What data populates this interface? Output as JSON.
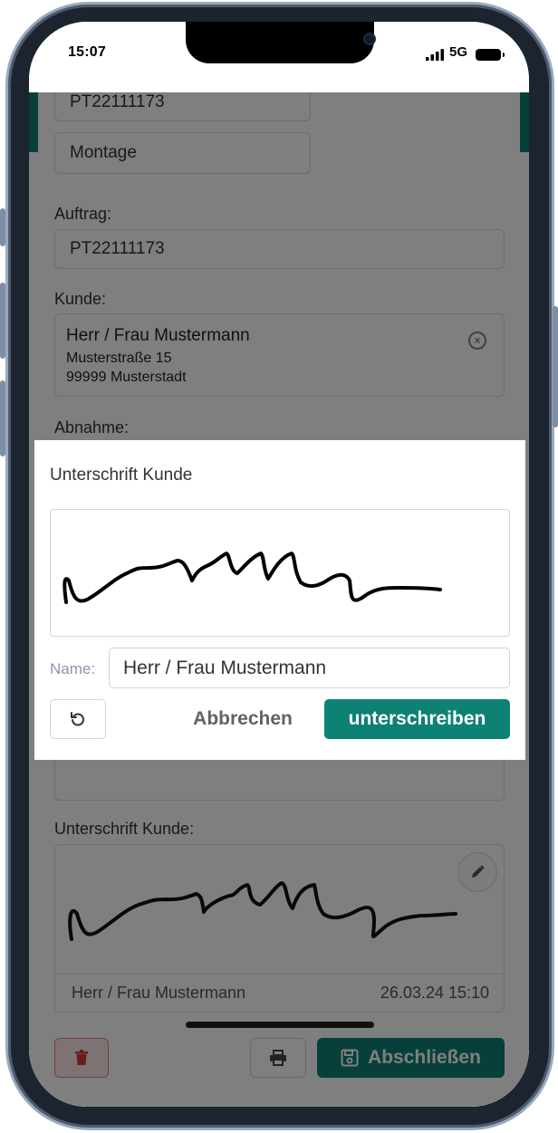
{
  "status_bar": {
    "time": "15:07",
    "network": "5G",
    "signal_icon": "signal-bars-icon",
    "battery_icon": "battery-icon"
  },
  "form": {
    "order_number_top": "PT22111173",
    "type_value": "Montage",
    "auftrag_label": "Auftrag:",
    "auftrag_value": "PT22111173",
    "kunde_label": "Kunde:",
    "kunde_name": "Herr / Frau Mustermann",
    "kunde_street": "Musterstraße 15",
    "kunde_city": "99999 Musterstadt",
    "abnahme_label": "Abnahme:",
    "signature_label": "Unterschrift Kunde:",
    "signature_name": "Herr / Frau Mustermann",
    "signature_date": "26.03.24 15:10",
    "finish_label": "Abschließen"
  },
  "modal": {
    "title": "Unterschrift Kunde",
    "name_label": "Name:",
    "name_value": "Herr / Frau Mustermann",
    "cancel_label": "Abbrechen",
    "sign_label": "unterschreiben"
  },
  "colors": {
    "accent": "#0e8175",
    "danger": "#d63a3a",
    "overlay": "rgba(0,0,0,0.5)"
  }
}
